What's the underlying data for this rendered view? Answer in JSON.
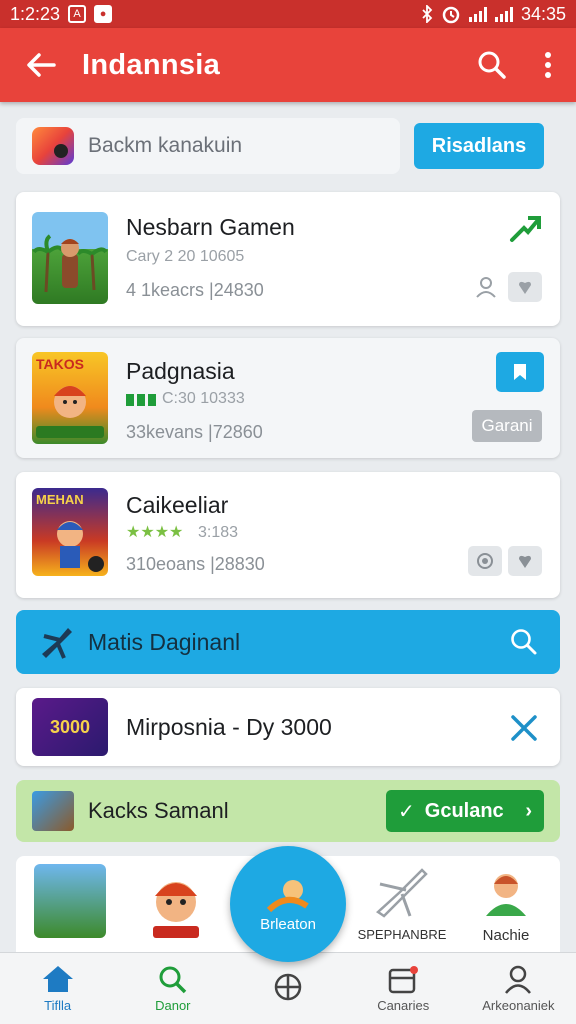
{
  "status_bar": {
    "time": "1:2:23",
    "icon_a": "A",
    "icon_b": "●",
    "clock": "34:35"
  },
  "app_bar": {
    "title": "Indannsia"
  },
  "search": {
    "text": "Backm kanakuin",
    "button_label": "Risadlans"
  },
  "games": [
    {
      "name": "Nesbarn Gamen",
      "sub": "Cary 2 20 10605",
      "stats": "4 1keacrs  |24830"
    },
    {
      "name": "Padgnasia",
      "sub": "C:30 10333",
      "stats": "33kevans  |72860",
      "button_label": "Garani"
    },
    {
      "name": "Caikeeliar",
      "sub": "3:183",
      "stats": "310eoans  |28830"
    }
  ],
  "thumb_texts": {
    "game2": "TAKOS",
    "game3": "MEHAN"
  },
  "blue_banner": {
    "label": "Matis Daginanl"
  },
  "promo": {
    "label": "Mirposnia - Dy 3000",
    "thumb_text": "3000"
  },
  "green_banner": {
    "label": "Kacks Samanl",
    "button_label": "Gculanc"
  },
  "icon_row": [
    {
      "label": ""
    },
    {
      "label": ""
    },
    {
      "label": "SPEPHANBRE"
    },
    {
      "label": "Nachie"
    }
  ],
  "fab": {
    "label": "Brleaton"
  },
  "bottom_nav": [
    {
      "label": "Tiflla"
    },
    {
      "label": "Danor"
    },
    {
      "label": ""
    },
    {
      "label": "Canaries"
    },
    {
      "label": "Arkeonaniek"
    }
  ],
  "colors": {
    "app_bar": "#e8433b",
    "accent_blue": "#1ea9e3",
    "accent_green": "#1f9d3a",
    "banner_green": "#c3e6a8"
  }
}
